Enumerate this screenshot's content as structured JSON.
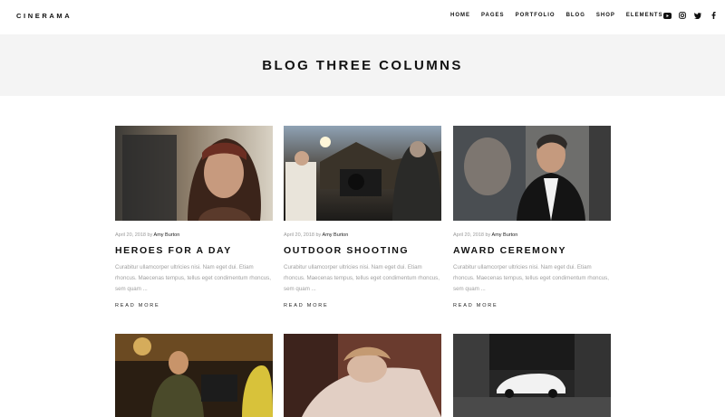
{
  "brand": {
    "logo": "CINERAMA"
  },
  "nav": {
    "items": [
      "HOME",
      "PAGES",
      "PORTFOLIO",
      "BLOG",
      "SHOP",
      "ELEMENTS"
    ]
  },
  "socials": [
    "youtube-icon",
    "instagram-icon",
    "twitter-icon",
    "facebook-icon"
  ],
  "page": {
    "title": "BLOG THREE COLUMNS"
  },
  "posts": [
    {
      "date": "April 20, 2018",
      "by": "by",
      "author": "Amy Burton",
      "title": "HEROES FOR A DAY",
      "excerpt": "Curabitur ullamcorper ultricies nisi. Nam eget dui. Etiam rhoncus. Maecenas tempus, tellus eget condimentum rhoncus, sem quam ...",
      "read_more": "READ MORE"
    },
    {
      "date": "April 20, 2018",
      "by": "by",
      "author": "Amy Burton",
      "title": "OUTDOOR SHOOTING",
      "excerpt": "Curabitur ullamcorper ultricies nisi. Nam eget dui. Etiam rhoncus. Maecenas tempus, tellus eget condimentum rhoncus, sem quam ...",
      "read_more": "READ MORE"
    },
    {
      "date": "April 20, 2018",
      "by": "by",
      "author": "Amy Burton",
      "title": "AWARD CEREMONY",
      "excerpt": "Curabitur ullamcorper ultricies nisi. Nam eget dui. Etiam rhoncus. Maecenas tempus, tellus eget condimentum rhoncus, sem quam ...",
      "read_more": "READ MORE"
    }
  ],
  "colors": {
    "text": "#111111",
    "muted": "#a0a0a0",
    "title_band": "#f4f4f4"
  }
}
